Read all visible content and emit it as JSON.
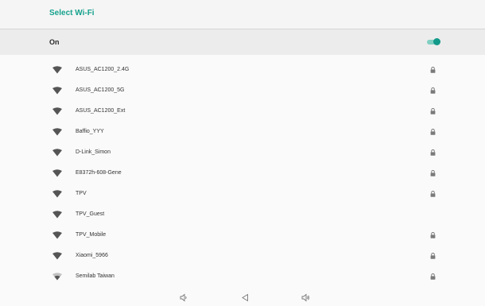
{
  "header": {
    "title": "Select Wi-Fi"
  },
  "wifi_toggle": {
    "label": "On",
    "state": "on"
  },
  "networks": [
    {
      "ssid": "ASUS_AC1200_2.4G",
      "secured": true,
      "signal": "full"
    },
    {
      "ssid": "ASUS_AC1200_5G",
      "secured": true,
      "signal": "full"
    },
    {
      "ssid": "ASUS_AC1200_Ext",
      "secured": true,
      "signal": "full"
    },
    {
      "ssid": "Baffio_YYY",
      "secured": true,
      "signal": "full"
    },
    {
      "ssid": "D-Link_Simon",
      "secured": true,
      "signal": "full"
    },
    {
      "ssid": "E8372h-608-Gene",
      "secured": true,
      "signal": "full"
    },
    {
      "ssid": "TPV",
      "secured": true,
      "signal": "full"
    },
    {
      "ssid": "TPV_Guest",
      "secured": false,
      "signal": "full"
    },
    {
      "ssid": "TPV_Mobile",
      "secured": true,
      "signal": "full"
    },
    {
      "ssid": "Xiaomi_5966",
      "secured": true,
      "signal": "full"
    },
    {
      "ssid": "Semilab Taiwan",
      "secured": true,
      "signal": "partial"
    }
  ],
  "icons": {
    "wifi": "wifi-signal-icon",
    "lock": "lock-icon"
  },
  "colors": {
    "accent": "#16a28d",
    "toggle_thumb": "#11998a",
    "toggle_track": "#7fcfc2",
    "icon": "#555555"
  },
  "navigation": {
    "buttons": [
      "volume-down",
      "back",
      "volume-up"
    ]
  }
}
